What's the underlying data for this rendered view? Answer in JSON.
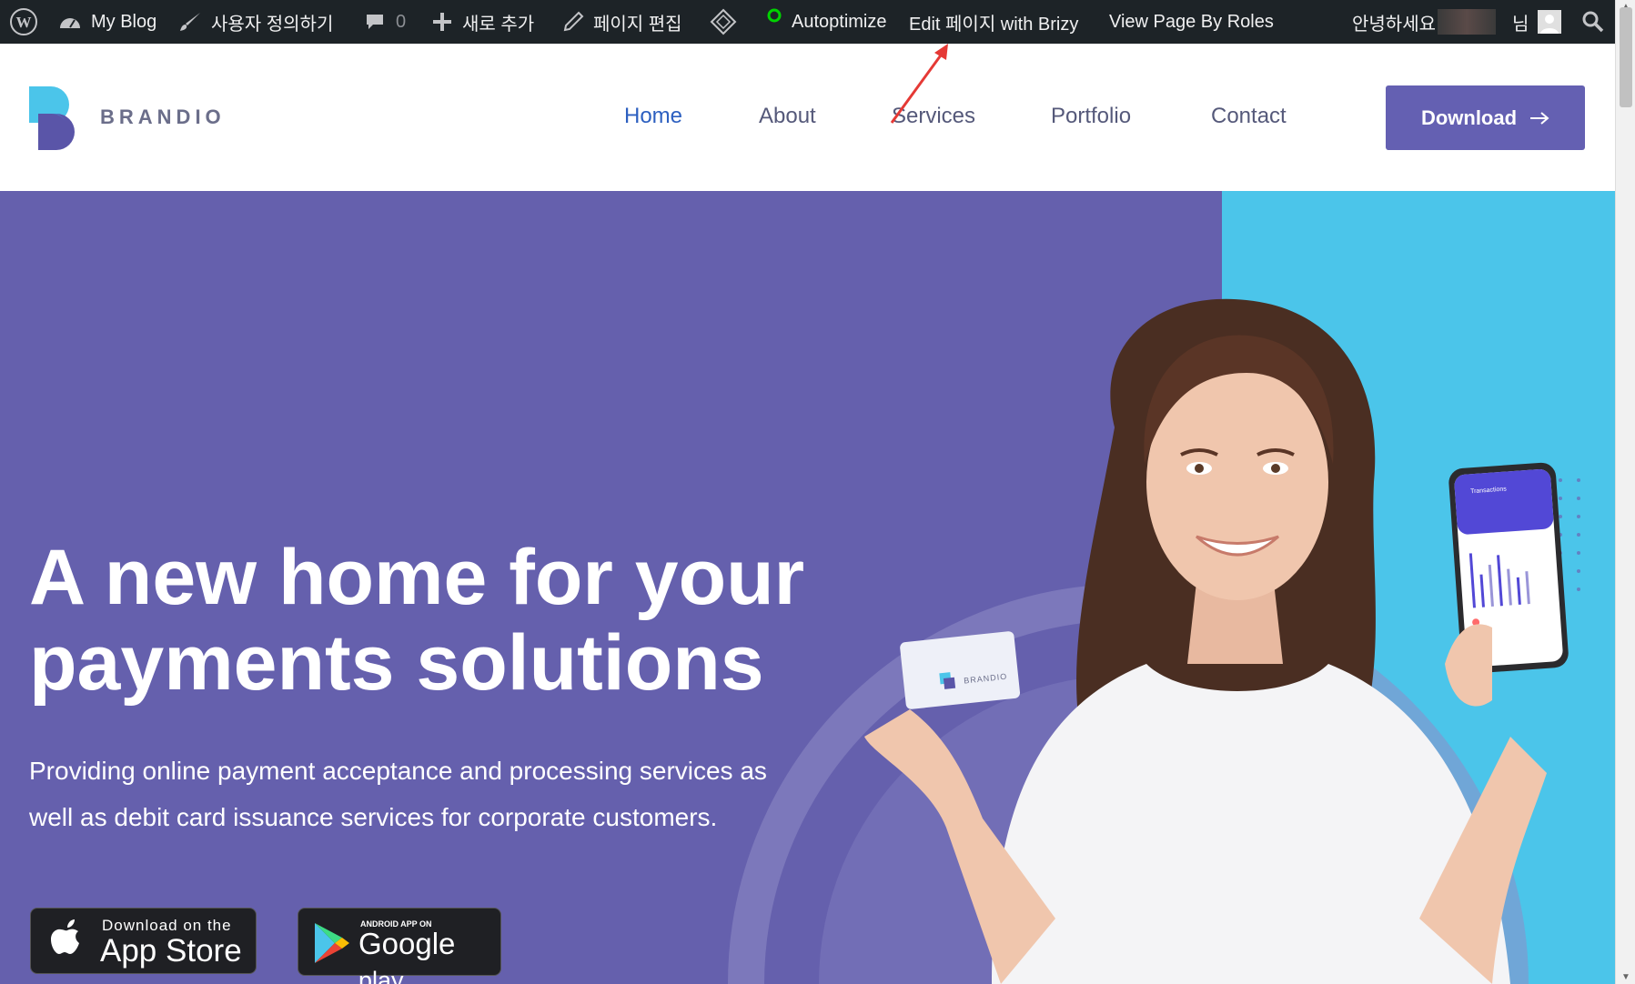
{
  "adminbar": {
    "site_name": "My Blog",
    "customize": "사용자 정의하기",
    "comments_count": "0",
    "new_content": "새로 추가",
    "edit_page": "페이지 편집",
    "autoptimize": "Autoptimize",
    "edit_with_brizy": "Edit 페이지 with Brizy",
    "view_by_roles": "View Page By Roles",
    "greeting": "안녕하세요",
    "honorific": "님"
  },
  "header": {
    "logo_text": "BRANDIO",
    "nav": [
      {
        "label": "Home"
      },
      {
        "label": "About"
      },
      {
        "label": "Services"
      },
      {
        "label": "Portfolio"
      },
      {
        "label": "Contact"
      }
    ],
    "download_label": "Download"
  },
  "hero": {
    "title_line1": "A new home for your",
    "title_line2": "payments solutions",
    "subtitle_line1": "Providing online payment acceptance and processing services as",
    "subtitle_line2": "well as debit card issuance services for corporate customers.",
    "app_store_small": "Download on the",
    "app_store_big": "App Store",
    "google_small": "ANDROID APP ON",
    "google_big": "Google",
    "google_play": "play",
    "card_brand": "BRANDIO",
    "phone_title": "Transactions"
  },
  "colors": {
    "adminbar_bg": "#1d2327",
    "hero_purple": "#6560ad",
    "hero_blue": "#4bc5ea",
    "nav_active": "#2c5fc0",
    "button_bg": "#6460b2",
    "annotation_red": "#e53935"
  }
}
